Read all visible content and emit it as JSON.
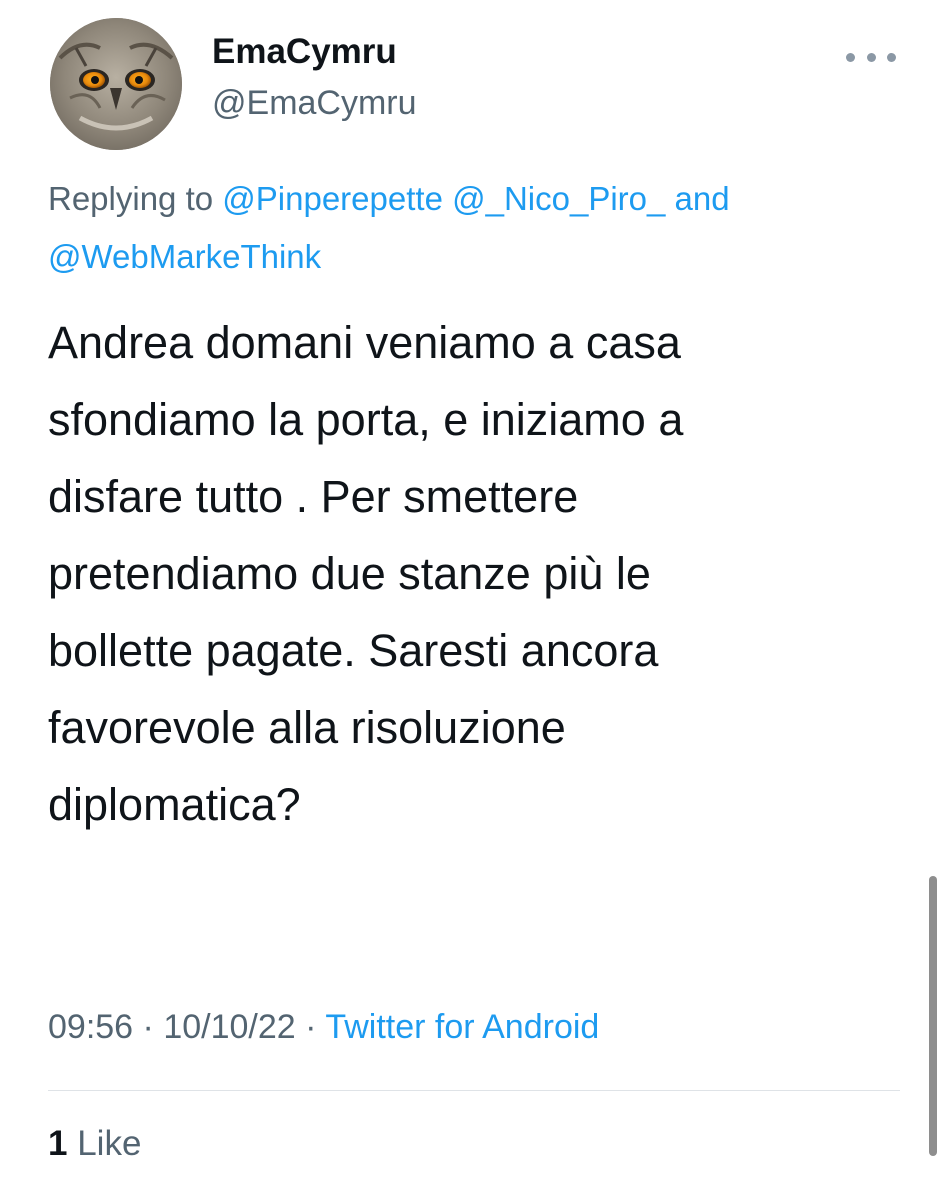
{
  "author": {
    "display_name": "EmaCymru",
    "handle": "@EmaCymru",
    "avatar_icon": "owl-avatar"
  },
  "reply": {
    "prefix": "Replying to",
    "mentions": [
      "@Pinperepette",
      "@_Nico_Piro_",
      "@WebMarkeThink"
    ],
    "conjunction": "and"
  },
  "tweet": {
    "lines": [
      "Andrea domani veniamo a casa",
      "sfondiamo la porta, e iniziamo a",
      "disfare tutto . Per smettere",
      "pretendiamo due stanze più le",
      "bollette pagate. Saresti ancora",
      "favorevole alla risoluzione",
      "diplomatica?"
    ]
  },
  "meta": {
    "time": "09:56",
    "separator": "·",
    "date": "10/10/22",
    "source": "Twitter for Android"
  },
  "engagement": {
    "like_count": "1",
    "like_label": "Like"
  },
  "colors": {
    "accent": "#1d9bf0",
    "secondary_text": "#536471",
    "primary_text": "#0f1419"
  }
}
